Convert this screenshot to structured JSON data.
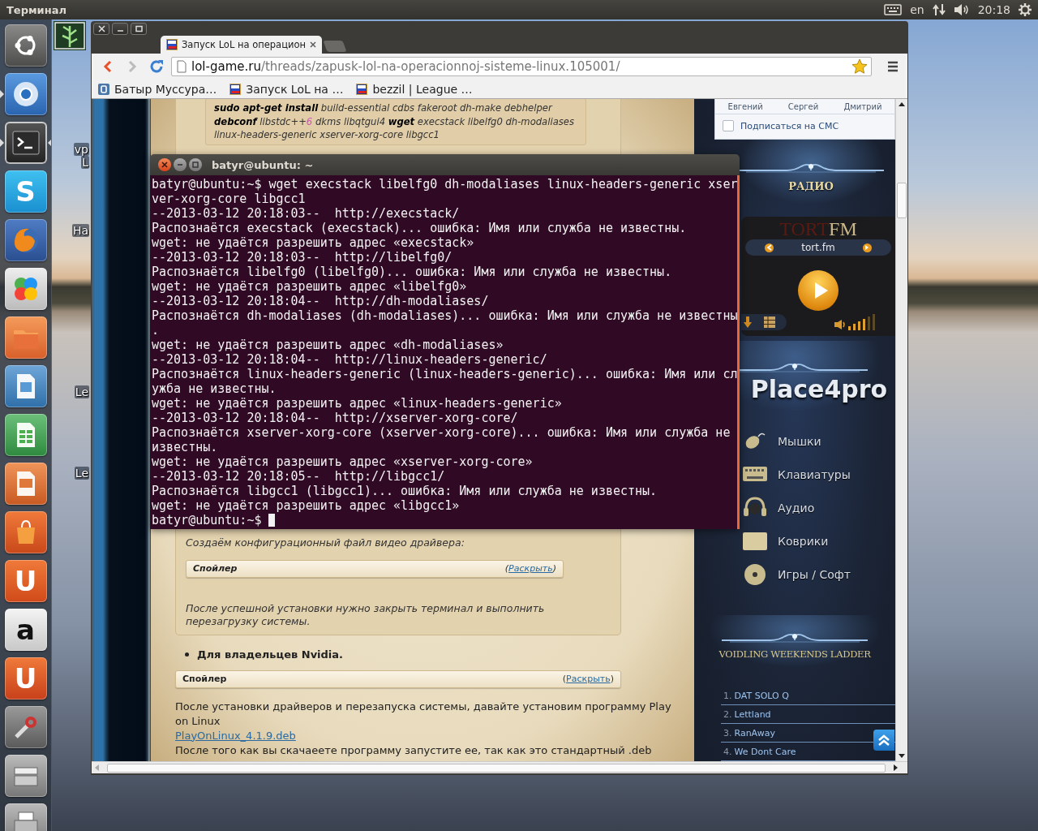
{
  "top_panel": {
    "title": "Терминал",
    "language": "en",
    "clock": "20:18"
  },
  "launcher": [
    {
      "kind": "dash",
      "running": false,
      "focused": false
    },
    {
      "kind": "chromium",
      "running": true,
      "focused": false
    },
    {
      "kind": "terminal",
      "running": true,
      "focused": true
    },
    {
      "kind": "skype",
      "glyph": "S",
      "running": false,
      "focused": false
    },
    {
      "kind": "firefox",
      "running": false,
      "focused": false
    },
    {
      "kind": "crossover",
      "running": false,
      "focused": false
    },
    {
      "kind": "files",
      "running": false,
      "focused": false
    },
    {
      "kind": "document",
      "running": false,
      "focused": false
    },
    {
      "kind": "spreadsheet",
      "running": false,
      "focused": false
    },
    {
      "kind": "presentation",
      "running": false,
      "focused": false
    },
    {
      "kind": "software-center",
      "running": false,
      "focused": false
    },
    {
      "kind": "ubuntu-one",
      "glyph": "U",
      "running": false,
      "focused": false
    },
    {
      "kind": "amazon",
      "glyph": "a",
      "running": false,
      "focused": false
    },
    {
      "kind": "music",
      "glyph": "U",
      "running": false,
      "focused": false
    },
    {
      "kind": "settings",
      "running": false,
      "focused": false
    },
    {
      "kind": "scanner",
      "running": false,
      "focused": false
    },
    {
      "kind": "printer",
      "running": false,
      "focused": false
    }
  ],
  "desktop_labels": [
    "vp",
    "L",
    "Ha",
    "Le",
    "Le"
  ],
  "browser": {
    "tabs": [
      {
        "title": "Запуск LoL на операцион",
        "selected": true
      }
    ],
    "back_enabled": true,
    "forward_enabled": false,
    "url": {
      "host": "lol-game.ru",
      "path": "/threads/zapusk-lol-na-operacionnoj-sisteme-linux.105001/"
    },
    "starred": true,
    "bookmarks": [
      {
        "kind": "vk",
        "label": "Батыр Муссура…"
      },
      {
        "kind": "lol",
        "label": "Запуск LoL на …"
      },
      {
        "kind": "lol",
        "label": "bezzil | League …"
      }
    ]
  },
  "article": {
    "command": [
      {
        "kind": "command",
        "text": "sudo apt-get install"
      },
      {
        "kind": "argument",
        "text": " build-essential cdbs fakeroot dh-make debhelper "
      },
      {
        "kind": "command",
        "text": "debconf"
      },
      {
        "kind": "argument",
        "text": " libstdc++"
      },
      {
        "kind": "number",
        "text": "6"
      },
      {
        "kind": "argument",
        "text": " dkms libqtgui4 "
      },
      {
        "kind": "command",
        "text": "wget"
      },
      {
        "kind": "argument",
        "text": " execstack libelfg0 dh-modaliases linux-headers-generic xserver-xorg-core libgcc1"
      }
    ],
    "config_note": "Создаём конфигурационный файл видео драйвера:",
    "spoiler_1": {
      "title": "Спойлер",
      "action": "(Раскрыть)"
    },
    "reboot_note": "После успешной установки нужно закрыть терминал и выполнить перезагрузку системы.",
    "bullet": "Для владельцев Nvidia.",
    "spoiler_2": {
      "title": "Спойлер",
      "action": "(Раскрыть)"
    },
    "paragraph_1": "После установки драйверов и перезапуска системы, давайте установим программу Play on Linux",
    "download_link": "PlayOnLinux_4.1.9.deb",
    "paragraph_2": "После того как вы скачаеете программу запустите ее, так как это стандартный .deb"
  },
  "sidebar": {
    "contacts": [
      "Евгений",
      "Сергей",
      "Дмитрий"
    ],
    "subscribe": {
      "label": "Подписаться на СМС",
      "checked": false
    },
    "radio_title": "РАДИО",
    "radio_logo": [
      "TORT",
      "FM"
    ],
    "station": "tort.fm",
    "volume": {
      "level": 0.67
    },
    "brand": "Place4pro",
    "menu": [
      {
        "kind": "mouse",
        "label": "Мышки"
      },
      {
        "kind": "keyboard",
        "label": "Клавиатуры"
      },
      {
        "kind": "headphones",
        "label": "Аудио"
      },
      {
        "kind": "mousepad",
        "label": "Коврики"
      },
      {
        "kind": "disc",
        "label": "Игры / Софт"
      }
    ],
    "ladder_title": "VOIDLING WEEKENDS LADDER",
    "ladder": [
      {
        "rank": "1.",
        "name": "DAT SOLO Q"
      },
      {
        "rank": "2.",
        "name": "Lettland"
      },
      {
        "rank": "3.",
        "name": "RanAway"
      },
      {
        "rank": "4.",
        "name": "We Dont Care"
      }
    ]
  },
  "terminal": {
    "title": "batyr@ubuntu: ~",
    "lines": [
      "batyr@ubuntu:~$ wget execstack libelfg0 dh-modaliases linux-headers-generic xser",
      "ver-xorg-core libgcc1",
      "--2013-03-12 20:18:03--  http://execstack/",
      "Распознаётся execstack (execstack)... ошибка: Имя или служба не известны.",
      "wget: не удаётся разрешить адрес «execstack»",
      "--2013-03-12 20:18:03--  http://libelfg0/",
      "Распознаётся libelfg0 (libelfg0)... ошибка: Имя или служба не известны.",
      "wget: не удаётся разрешить адрес «libelfg0»",
      "--2013-03-12 20:18:04--  http://dh-modaliases/",
      "Распознаётся dh-modaliases (dh-modaliases)... ошибка: Имя или служба не известны",
      ".",
      "wget: не удаётся разрешить адрес «dh-modaliases»",
      "--2013-03-12 20:18:04--  http://linux-headers-generic/",
      "Распознаётся linux-headers-generic (linux-headers-generic)... ошибка: Имя или сл",
      "ужба не известны.",
      "wget: не удаётся разрешить адрес «linux-headers-generic»",
      "--2013-03-12 20:18:04--  http://xserver-xorg-core/",
      "Распознаётся xserver-xorg-core (xserver-xorg-core)... ошибка: Имя или служба не",
      "известны.",
      "wget: не удаётся разрешить адрес «xserver-xorg-core»",
      "--2013-03-12 20:18:05--  http://libgcc1/",
      "Распознаётся libgcc1 (libgcc1)... ошибка: Имя или служба не известны.",
      "wget: не удаётся разрешить адрес «libgcc1»"
    ],
    "prompt": "batyr@ubuntu:~$"
  }
}
